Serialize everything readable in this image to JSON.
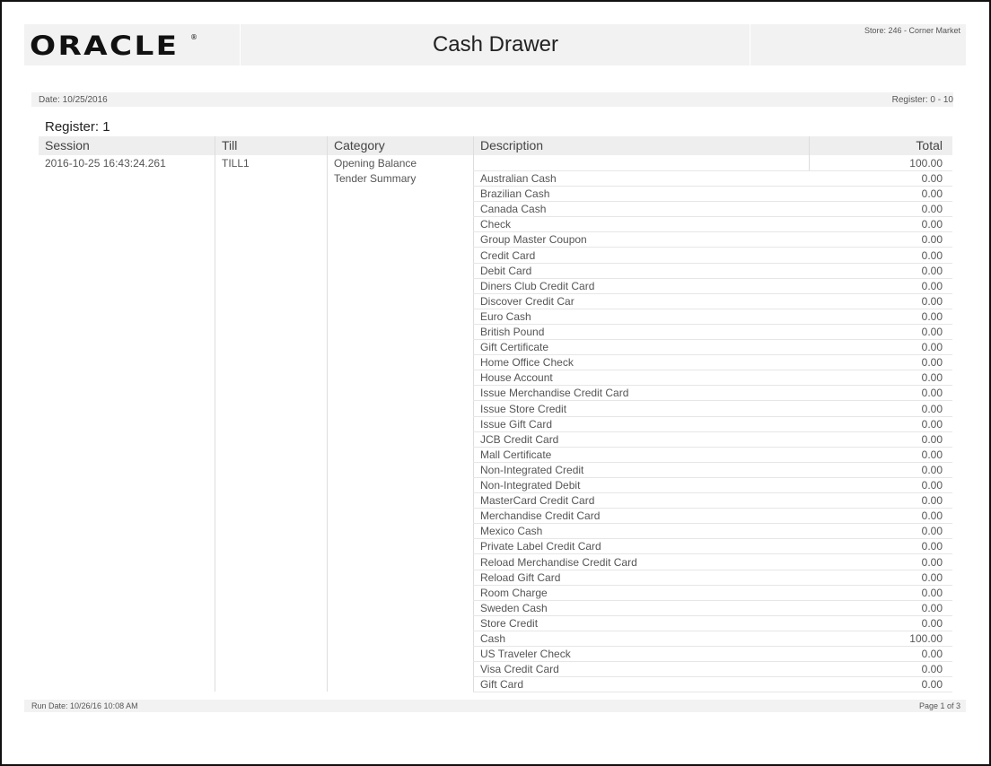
{
  "header": {
    "logo_text": "ORACLE",
    "logo_mark": "®",
    "title": "Cash Drawer",
    "store": "Store: 246 - Corner Market"
  },
  "subheader": {
    "date": "Date: 10/25/2016",
    "register_range": "Register: 0 - 10"
  },
  "section": {
    "register_title": "Register: 1"
  },
  "columns": {
    "session": "Session",
    "till": "Till",
    "category": "Category",
    "description": "Description",
    "total": "Total"
  },
  "record": {
    "session": "2016-10-25 16:43:24.261",
    "till": "TILL1",
    "opening_category": "Opening Balance",
    "opening_total": "100.00",
    "tender_category": "Tender Summary"
  },
  "tenders": [
    {
      "description": "Australian Cash",
      "total": "0.00"
    },
    {
      "description": "Brazilian Cash",
      "total": "0.00"
    },
    {
      "description": "Canada Cash",
      "total": "0.00"
    },
    {
      "description": "Check",
      "total": "0.00"
    },
    {
      "description": "Group Master Coupon",
      "total": "0.00"
    },
    {
      "description": "Credit Card",
      "total": "0.00"
    },
    {
      "description": "Debit Card",
      "total": "0.00"
    },
    {
      "description": "Diners Club Credit Card",
      "total": "0.00"
    },
    {
      "description": "Discover Credit Car",
      "total": "0.00"
    },
    {
      "description": "Euro Cash",
      "total": "0.00"
    },
    {
      "description": "British Pound",
      "total": "0.00"
    },
    {
      "description": "Gift Certificate",
      "total": "0.00"
    },
    {
      "description": "Home Office Check",
      "total": "0.00"
    },
    {
      "description": "House Account",
      "total": "0.00"
    },
    {
      "description": "Issue Merchandise Credit Card",
      "total": "0.00"
    },
    {
      "description": "Issue Store Credit",
      "total": "0.00"
    },
    {
      "description": "Issue Gift Card",
      "total": "0.00"
    },
    {
      "description": "JCB Credit Card",
      "total": "0.00"
    },
    {
      "description": "Mall Certificate",
      "total": "0.00"
    },
    {
      "description": "Non-Integrated Credit",
      "total": "0.00"
    },
    {
      "description": "Non-Integrated Debit",
      "total": "0.00"
    },
    {
      "description": "MasterCard Credit Card",
      "total": "0.00"
    },
    {
      "description": "Merchandise Credit Card",
      "total": "0.00"
    },
    {
      "description": "Mexico Cash",
      "total": "0.00"
    },
    {
      "description": "Private Label Credit Card",
      "total": "0.00"
    },
    {
      "description": "Reload Merchandise Credit Card",
      "total": "0.00"
    },
    {
      "description": "Reload Gift Card",
      "total": "0.00"
    },
    {
      "description": "Room Charge",
      "total": "0.00"
    },
    {
      "description": "Sweden Cash",
      "total": "0.00"
    },
    {
      "description": "Store Credit",
      "total": "0.00"
    },
    {
      "description": "Cash",
      "total": "100.00"
    },
    {
      "description": "US Traveler Check",
      "total": "0.00"
    },
    {
      "description": "Visa Credit Card",
      "total": "0.00"
    },
    {
      "description": "Gift Card",
      "total": "0.00"
    }
  ],
  "footer": {
    "run_date": "Run Date: 10/26/16 10:08 AM",
    "page": "Page 1 of 3"
  }
}
